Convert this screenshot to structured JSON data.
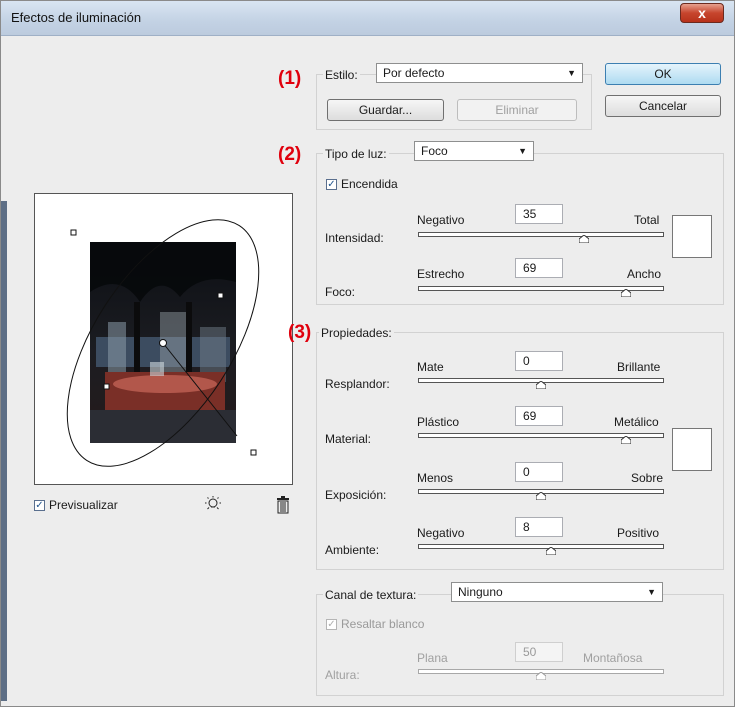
{
  "window": {
    "title": "Efectos de iluminación",
    "close_glyph": "x"
  },
  "annotations": {
    "n1": "(1)",
    "n2": "(2)",
    "n3": "(3)"
  },
  "preview": {
    "checkbox_label": "Previsualizar",
    "checked": true,
    "light_icon": "light-bulb-icon",
    "trash_icon": "trash-icon"
  },
  "estilo": {
    "label": "Estilo:",
    "value": "Por defecto",
    "guardar": "Guardar...",
    "eliminar": "Eliminar"
  },
  "buttons": {
    "ok": "OK",
    "cancel": "Cancelar"
  },
  "tipo": {
    "label": "Tipo de luz:",
    "value": "Foco",
    "encendida": "Encendida",
    "encendida_checked": true,
    "intensidad": {
      "label": "Intensidad:",
      "min": "Negativo",
      "max": "Total",
      "value": "35",
      "range": [
        -100,
        100
      ]
    },
    "foco": {
      "label": "Foco:",
      "min": "Estrecho",
      "max": "Ancho",
      "value": "69",
      "range": [
        -100,
        100
      ]
    }
  },
  "propiedades": {
    "label": "Propiedades:",
    "resplandor": {
      "label": "Resplandor:",
      "min": "Mate",
      "max": "Brillante",
      "value": "0",
      "range": [
        -100,
        100
      ]
    },
    "material": {
      "label": "Material:",
      "min": "Plástico",
      "max": "Metálico",
      "value": "69",
      "range": [
        -100,
        100
      ]
    },
    "exposicion": {
      "label": "Exposición:",
      "min": "Menos",
      "max": "Sobre",
      "value": "0",
      "range": [
        -100,
        100
      ]
    },
    "ambiente": {
      "label": "Ambiente:",
      "min": "Negativo",
      "max": "Positivo",
      "value": "8",
      "range": [
        -100,
        100
      ]
    }
  },
  "textura": {
    "label": "Canal de textura:",
    "value": "Ninguno",
    "resaltar": "Resaltar blanco",
    "resaltar_checked": true,
    "altura": {
      "label": "Altura:",
      "min": "Plana",
      "max": "Montañosa",
      "value": "50",
      "range": [
        0,
        100
      ]
    }
  },
  "colors": {
    "annotation": "#e0000d",
    "swatch_light": "#ffffff",
    "swatch_ambient": "#ffffff"
  }
}
